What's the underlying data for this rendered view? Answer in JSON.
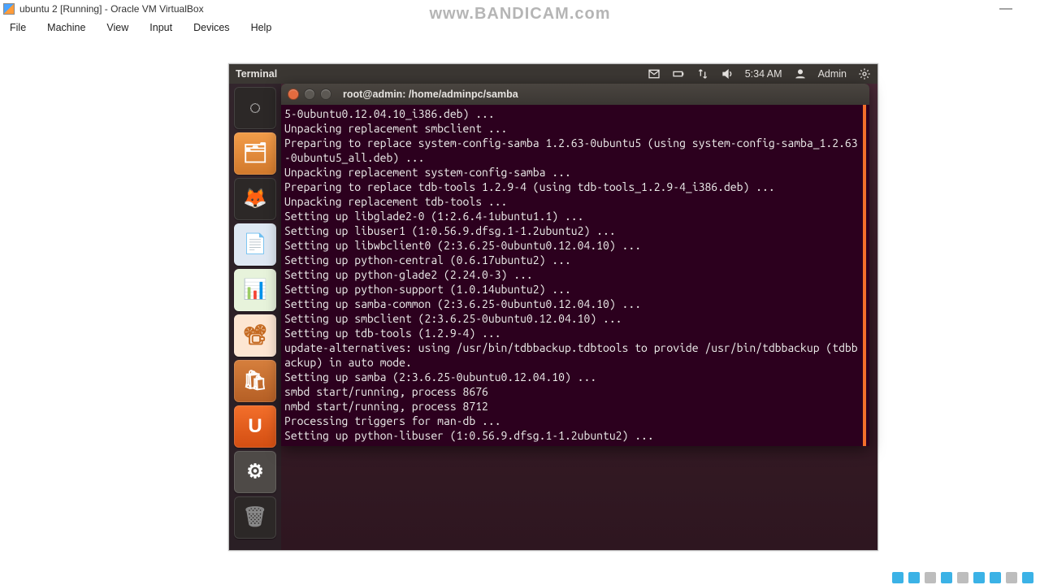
{
  "host_window": {
    "title": "ubuntu 2 [Running] - Oracle VM VirtualBox",
    "watermark": "www.BANDICAM.com",
    "menu": [
      "File",
      "Machine",
      "View",
      "Input",
      "Devices",
      "Help"
    ]
  },
  "panel": {
    "app_title": "Terminal",
    "time": "5:34 AM",
    "user": "Admin"
  },
  "launcher": {
    "items": [
      {
        "name": "dash",
        "glyph": "◌"
      },
      {
        "name": "files",
        "glyph": "🗂"
      },
      {
        "name": "firefox",
        "glyph": "🦊"
      },
      {
        "name": "writer",
        "glyph": "📄"
      },
      {
        "name": "calc",
        "glyph": "📊"
      },
      {
        "name": "impress",
        "glyph": "📽"
      },
      {
        "name": "software",
        "glyph": "🛍"
      },
      {
        "name": "ubuntu",
        "glyph": "U"
      },
      {
        "name": "settings",
        "glyph": "⚙"
      },
      {
        "name": "trash",
        "glyph": "🗑"
      }
    ]
  },
  "terminal": {
    "title": "root@admin: /home/adminpc/samba",
    "lines": [
      "5-0ubuntu0.12.04.10_i386.deb) ...",
      "Unpacking replacement smbclient ...",
      "Preparing to replace system-config-samba 1.2.63-0ubuntu5 (using system-config-samba_1.2.63-0ubuntu5_all.deb) ...",
      "Unpacking replacement system-config-samba ...",
      "Preparing to replace tdb-tools 1.2.9-4 (using tdb-tools_1.2.9-4_i386.deb) ...",
      "Unpacking replacement tdb-tools ...",
      "Setting up libglade2-0 (1:2.6.4-1ubuntu1.1) ...",
      "Setting up libuser1 (1:0.56.9.dfsg.1-1.2ubuntu2) ...",
      "Setting up libwbclient0 (2:3.6.25-0ubuntu0.12.04.10) ...",
      "Setting up python-central (0.6.17ubuntu2) ...",
      "Setting up python-glade2 (2.24.0-3) ...",
      "Setting up python-support (1.0.14ubuntu2) ...",
      "Setting up samba-common (2:3.6.25-0ubuntu0.12.04.10) ...",
      "Setting up smbclient (2:3.6.25-0ubuntu0.12.04.10) ...",
      "Setting up tdb-tools (1.2.9-4) ...",
      "update-alternatives: using /usr/bin/tdbbackup.tdbtools to provide /usr/bin/tdbbackup (tdbbackup) in auto mode.",
      "Setting up samba (2:3.6.25-0ubuntu0.12.04.10) ...",
      "smbd start/running, process 8676",
      "nmbd start/running, process 8712",
      "Processing triggers for man-db ...",
      "Setting up python-libuser (1:0.56.9.dfsg.1-1.2ubuntu2) ..."
    ]
  }
}
